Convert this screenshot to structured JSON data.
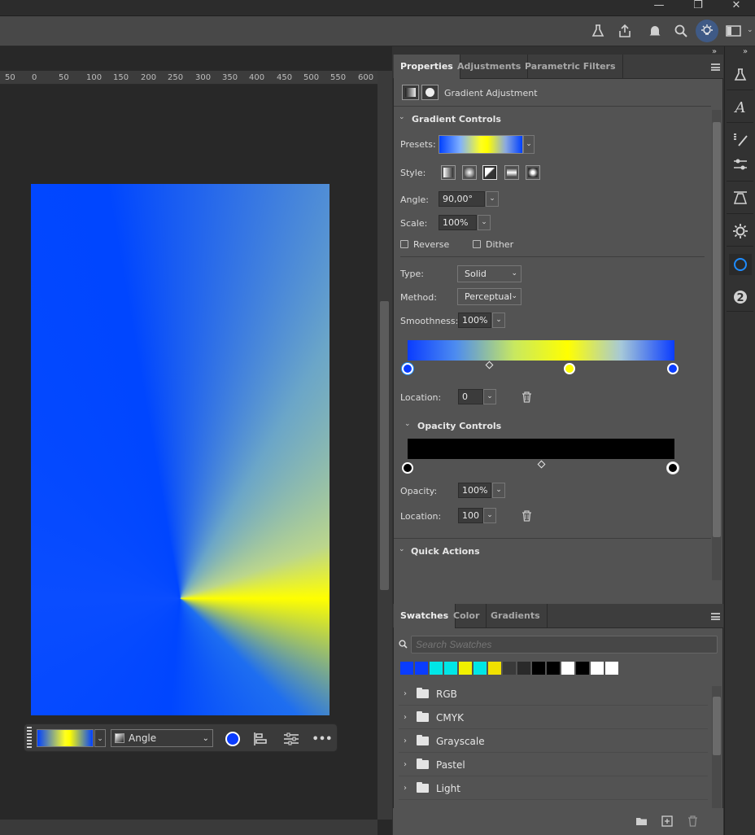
{
  "window": {
    "minimize": "—",
    "restore": "❐",
    "close": "✕"
  },
  "ruler": {
    "ticks": [
      "50",
      "0",
      "50",
      "100",
      "150",
      "200",
      "250",
      "300",
      "350",
      "400",
      "450",
      "500",
      "550",
      "600"
    ]
  },
  "context_bar": {
    "style_value": "Angle",
    "more": "•••"
  },
  "properties": {
    "tabs": [
      "Properties",
      "Adjustments",
      "Parametric Filters"
    ],
    "header_title": "Gradient Adjustment",
    "gradient_controls": {
      "title": "Gradient Controls",
      "presets_label": "Presets:",
      "style_label": "Style:",
      "angle_label": "Angle:",
      "angle_value": "90,00°",
      "scale_label": "Scale:",
      "scale_value": "100%",
      "reverse_label": "Reverse",
      "dither_label": "Dither",
      "type_label": "Type:",
      "type_value": "Solid",
      "method_label": "Method:",
      "method_value": "Perceptual",
      "smoothness_label": "Smoothness:",
      "smoothness_value": "100%",
      "location_label": "Location:",
      "location_value": "0"
    },
    "opacity_controls": {
      "title": "Opacity Controls",
      "opacity_label": "Opacity:",
      "opacity_value": "100%",
      "location_label": "Location:",
      "location_value": "100"
    },
    "quick_actions": {
      "title": "Quick Actions"
    }
  },
  "swatches": {
    "tabs": [
      "Swatches",
      "Color",
      "Gradients"
    ],
    "search_placeholder": "Search Swatches",
    "recent": [
      "#0a3cff",
      "#0a3cff",
      "#00e6e6",
      "#00e6e6",
      "#f0f000",
      "#00e6e6",
      "#f0e000",
      "#3a3a3a",
      "#2a2a2a",
      "#000000",
      "#000000",
      "#ffffff",
      "#000000",
      "#ffffff",
      "#ffffff"
    ],
    "groups": [
      "RGB",
      "CMYK",
      "Grayscale",
      "Pastel",
      "Light"
    ]
  },
  "colors": {
    "accent_blue": "#0a3cff",
    "accent_yellow": "#ffff00",
    "panel_bg": "#535353"
  }
}
